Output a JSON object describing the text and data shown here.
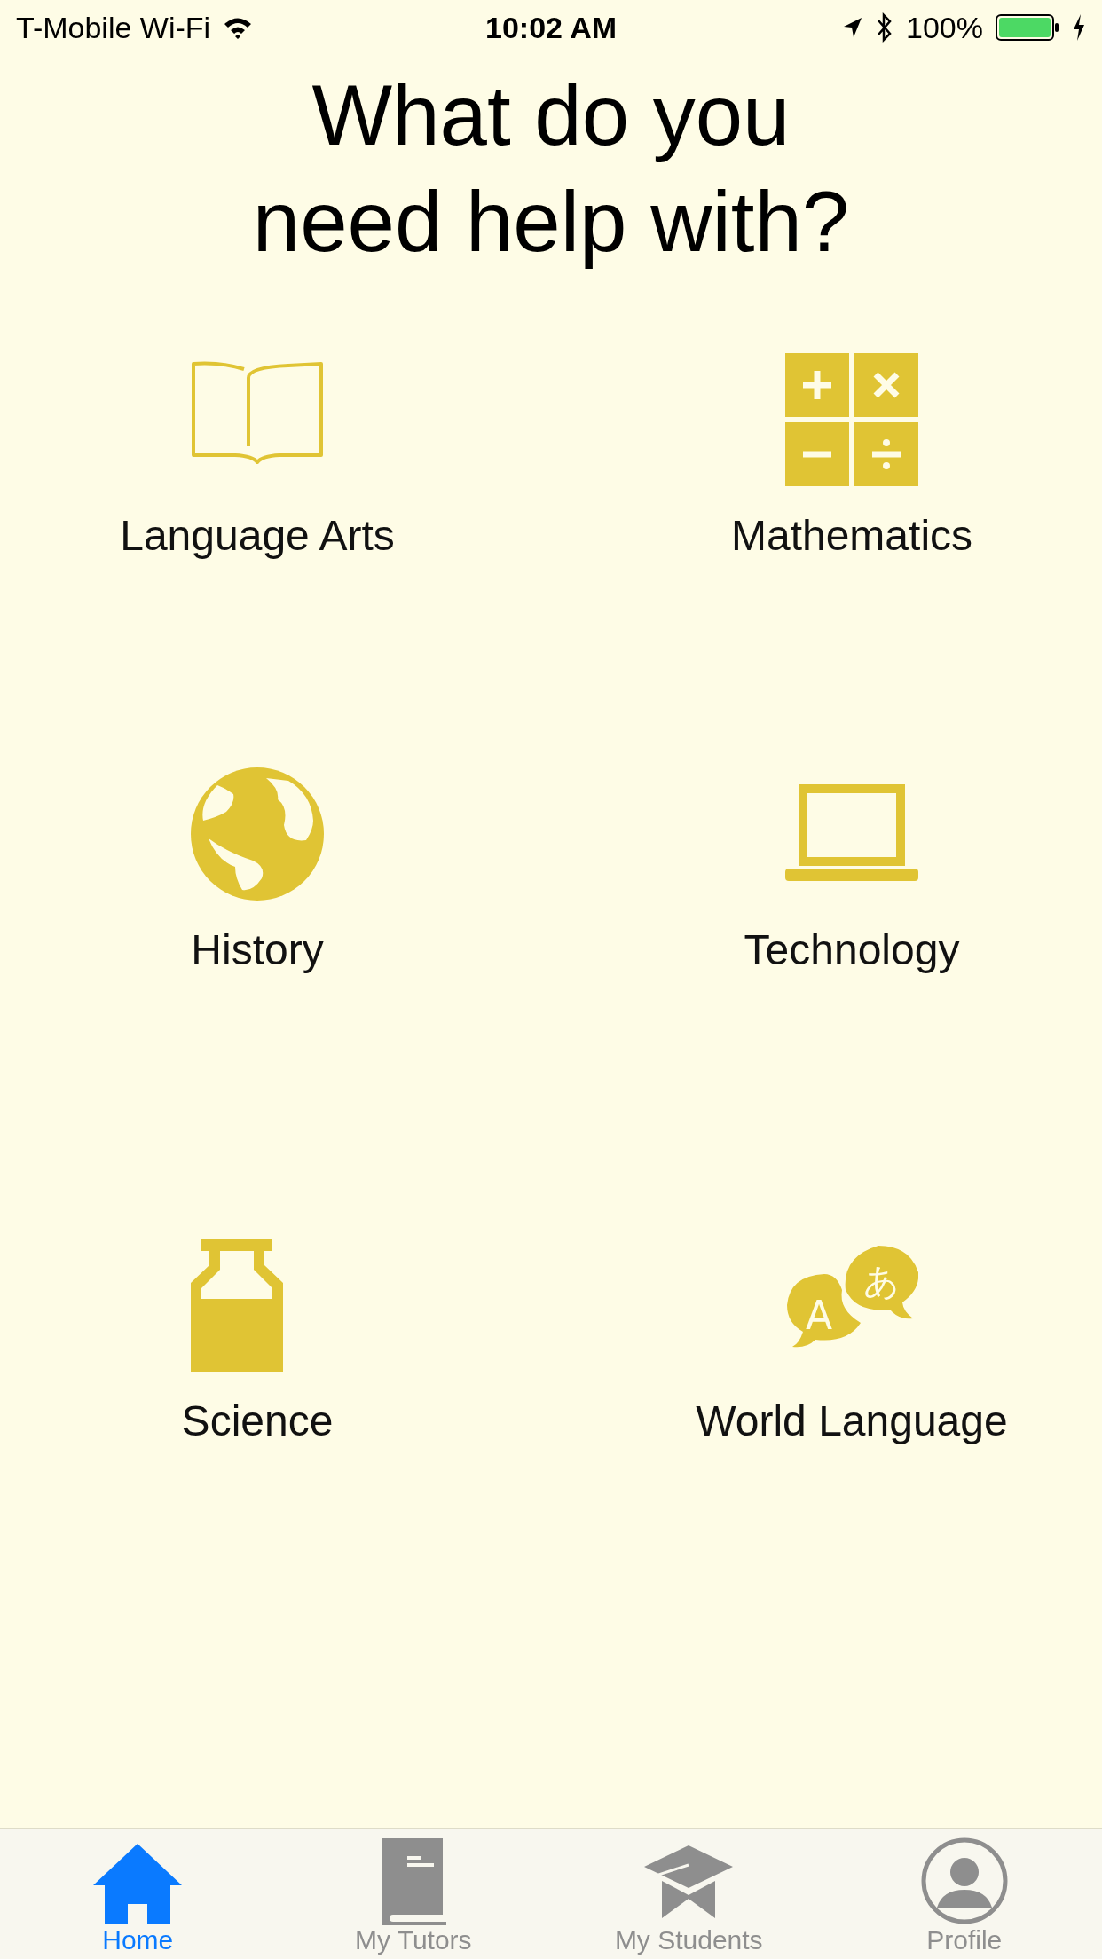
{
  "status_bar": {
    "carrier": "T-Mobile Wi-Fi",
    "time": "10:02 AM",
    "battery": "100%"
  },
  "title": "What do you\nneed help with?",
  "subjects": [
    {
      "kind": "book",
      "label": "Language Arts"
    },
    {
      "kind": "calculator",
      "label": "Mathematics"
    },
    {
      "kind": "globe",
      "label": "History"
    },
    {
      "kind": "laptop",
      "label": "Technology"
    },
    {
      "kind": "bottle",
      "label": "Science"
    },
    {
      "kind": "speech",
      "label": "World Language"
    }
  ],
  "translation_icon_glyphs": [
    "A",
    "あ"
  ],
  "tabs": [
    {
      "kind": "home",
      "label": "Home",
      "selected": true
    },
    {
      "kind": "book",
      "label": "My Tutors",
      "selected": false
    },
    {
      "kind": "cap",
      "label": "My Students",
      "selected": false
    },
    {
      "kind": "person",
      "label": "Profile",
      "selected": false
    }
  ]
}
